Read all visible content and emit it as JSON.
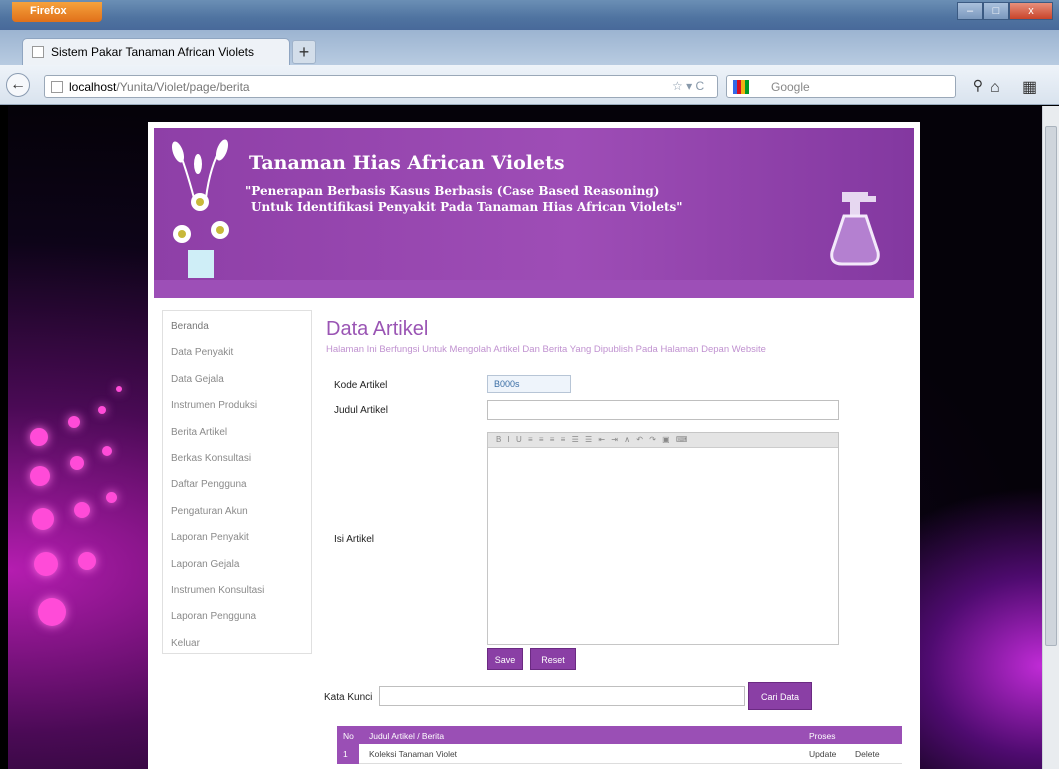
{
  "browser": {
    "app_button": "Firefox",
    "tab_title": "Sistem Pakar Tanaman African Violets",
    "new_tab": "+",
    "url_host": "localhost",
    "url_path": "/Yunita/Violet/page/berita",
    "search_placeholder": "Google",
    "window_controls": [
      "–",
      "□",
      "x"
    ]
  },
  "banner": {
    "title": "Tanaman Hias African Violets",
    "subtitle_line1": "\"Penerapan Berbasis Kasus Berbasis (Case Based Reasoning)",
    "subtitle_line2": "Untuk Identifikasi Penyakit Pada Tanaman Hias African Violets\""
  },
  "sidebar": {
    "items": [
      "Beranda",
      "Data Penyakit",
      "Data Gejala",
      "Instrumen Produksi",
      "Berita Artikel",
      "Berkas Konsultasi",
      "Daftar Pengguna",
      "Pengaturan Akun",
      "Laporan Penyakit",
      "Laporan Gejala",
      "Instrumen Konsultasi",
      "Laporan Pengguna",
      "Keluar"
    ]
  },
  "content": {
    "title": "Data Artikel",
    "subtitle": "Halaman Ini Berfungsi Untuk Mengolah Artikel Dan Berita Yang Dipublish Pada Halaman Depan Website",
    "form": {
      "kode_label": "Kode Artikel",
      "kode_value": "B000s",
      "judul_label": "Judul Artikel",
      "judul_value": "",
      "isi_label": "Isi Artikel",
      "editor_toolbar": "B I U ≡ ≡ ≡ ≡ ☰ ☰ ⇤ ⇥ ∧ ↶ ↷ ▣ ⌨"
    },
    "buttons": {
      "save": "Save",
      "reset": "Reset"
    },
    "search": {
      "label": "Kata Kunci",
      "value": "",
      "button": "Cari Data"
    },
    "table": {
      "headers": [
        "No",
        "Judul Artikel / Berita",
        "Proses"
      ],
      "rows": [
        {
          "no": "1",
          "judul": "Koleksi Tanaman Violet",
          "update": "Update",
          "delete": "Delete"
        }
      ]
    }
  },
  "colors": {
    "accent": "#9a4fb5",
    "banner": "#9e4db6",
    "title": "#9a55b4"
  }
}
